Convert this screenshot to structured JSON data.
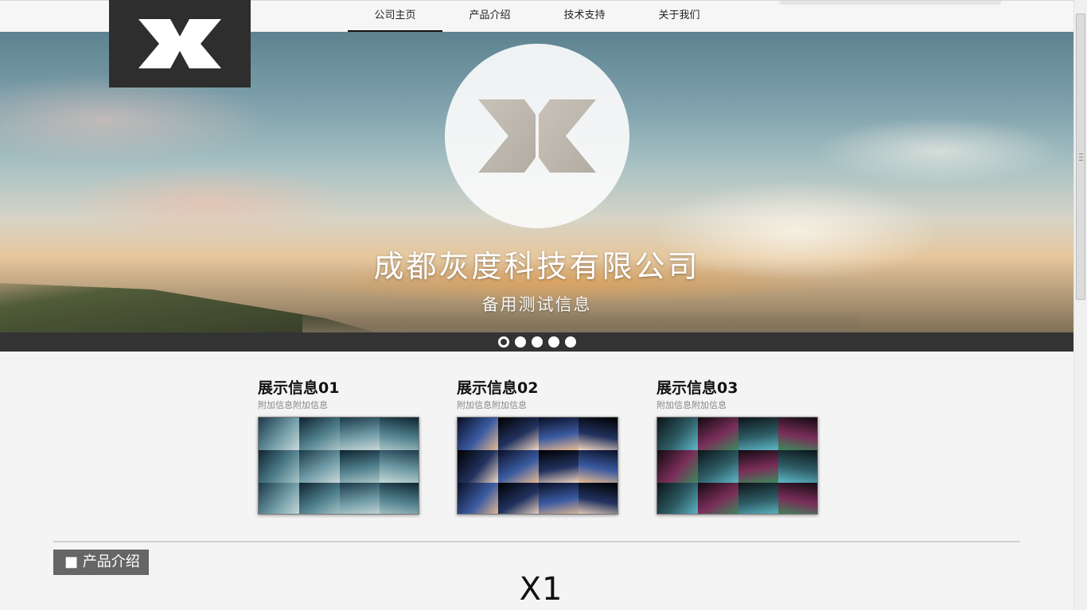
{
  "nav": {
    "items": [
      {
        "label": "公司主页",
        "active": true
      },
      {
        "label": "产品介绍",
        "active": false
      },
      {
        "label": "技术支持",
        "active": false
      },
      {
        "label": "关于我们",
        "active": false
      }
    ]
  },
  "logo": {
    "icon": "x-logo-icon"
  },
  "hero": {
    "title": "成都灰度科技有限公司",
    "subtitle": "备用测试信息",
    "slide_count": 5,
    "active_slide": 1
  },
  "showcase": [
    {
      "title": "展示信息01",
      "subtitle": "附加信息附加信息",
      "image": "bridge-thumbnail"
    },
    {
      "title": "展示信息02",
      "subtitle": "附加信息附加信息",
      "image": "city-night-thumbnail"
    },
    {
      "title": "展示信息03",
      "subtitle": "附加信息附加信息",
      "image": "street-night-thumbnail"
    }
  ],
  "section": {
    "tab_label": "■ 产品介绍",
    "product_name": "X1"
  },
  "colors": {
    "logo_bg": "#2e2e2e",
    "dots_bar": "#333333",
    "section_tab": "#666666",
    "page_bg": "#f4f4f4"
  }
}
